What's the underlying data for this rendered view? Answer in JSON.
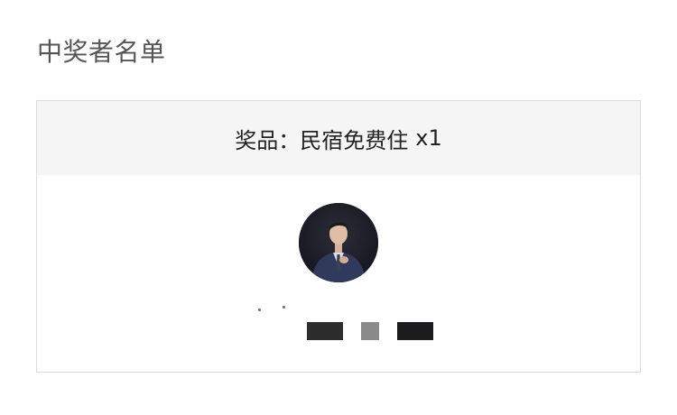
{
  "page": {
    "title": "中奖者名单"
  },
  "prize": {
    "label": "奖品：民宿免费住",
    "quantity": "x1"
  },
  "winner": {
    "avatar_icon": "person-avatar",
    "name_redacted": true
  }
}
